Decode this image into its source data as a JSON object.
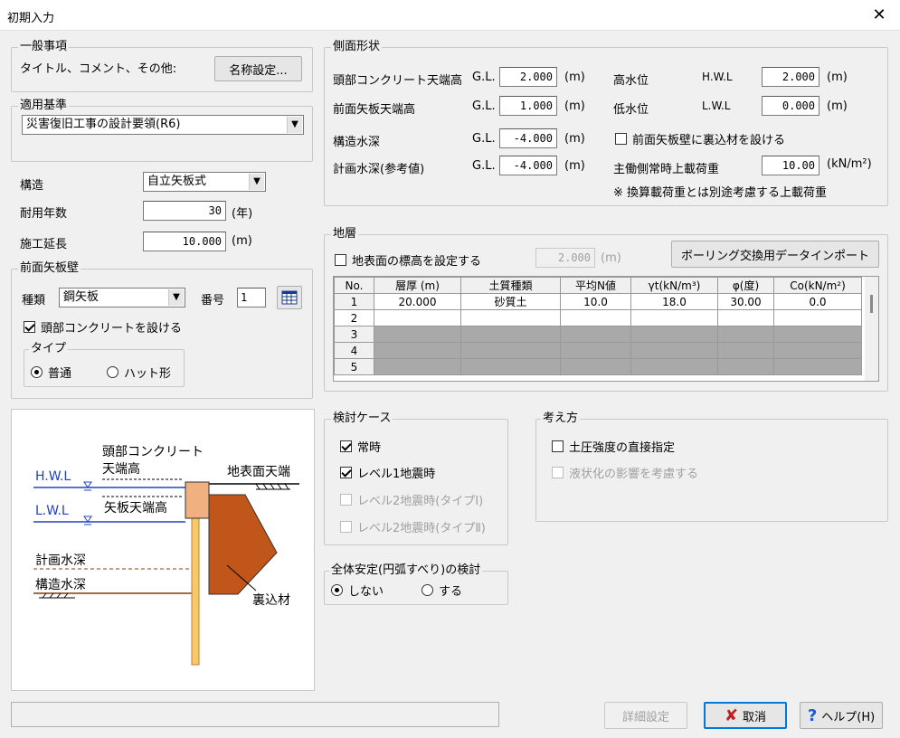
{
  "window": {
    "title": "初期入力",
    "close_glyph": "✕"
  },
  "general": {
    "label": "一般事項",
    "desc": "タイトル、コメント、その他:",
    "name_button": "名称設定..."
  },
  "standard": {
    "label": "適用基準",
    "value": "災害復旧工事の設計要領(R6)"
  },
  "structure": {
    "structure_label": "構造",
    "structure_value": "自立矢板式",
    "life_label": "耐用年数",
    "life_value": "30",
    "life_unit": "(年)",
    "length_label": "施工延長",
    "length_value": "10.000",
    "length_unit": "(m)"
  },
  "front_wall": {
    "label": "前面矢板壁",
    "kind_label": "種類",
    "kind_value": "鋼矢板",
    "number_label": "番号",
    "number_value": "1",
    "concrete_label": "頭部コンクリートを設ける",
    "type_label": "タイプ",
    "type_normal": "普通",
    "type_hat": "ハット形"
  },
  "diagram": {
    "label_head1": "頭部コンクリート",
    "label_head2": "天端高",
    "hwl": "H.W.L",
    "lwl": "L.W.L",
    "sheet_top": "矢板天端高",
    "ground_top": "地表面天端",
    "plan_depth": "計画水深",
    "struct_depth": "構造水深",
    "backfill": "裏込材"
  },
  "side": {
    "label": "側面形状",
    "head_top_label": "頭部コンクリート天端高",
    "gl": "G.L.",
    "head_top_value": "2.000",
    "unit_m": "(m)",
    "sheet_top_label": "前面矢板天端高",
    "sheet_top_value": "1.000",
    "struct_depth_label": "構造水深",
    "struct_depth_value": "-4.000",
    "plan_depth_label": "計画水深(参考値)",
    "plan_depth_value": "-4.000",
    "hwl_label": "高水位",
    "hwl_tag": "H.W.L",
    "hwl_value": "2.000",
    "lwl_label": "低水位",
    "lwl_tag": "L.W.L",
    "lwl_value": "0.000",
    "backfill_label": "前面矢板壁に裏込材を設ける",
    "load_label": "主働側常時上載荷重",
    "load_value": "10.00",
    "load_unit": "(kN/m²)",
    "note": "※ 換算載荷重とは別途考慮する上載荷重"
  },
  "strata": {
    "label": "地層",
    "surface_label": "地表面の標高を設定する",
    "surface_value": "2.000",
    "surface_unit": "(m)",
    "import_button": "ボーリング交換用データインポート",
    "headers": [
      "No.",
      "層厚 (m)",
      "土質種類",
      "平均N値",
      "γt(kN/m³)",
      "φ(度)",
      "Co(kN/m²)"
    ],
    "rows": [
      [
        "1",
        "20.000",
        "砂質土",
        "10.0",
        "18.0",
        "30.00",
        "0.0"
      ],
      [
        "2",
        "",
        "",
        "",
        "",
        "",
        ""
      ],
      [
        "3",
        "",
        "",
        "",
        "",
        "",
        ""
      ],
      [
        "4",
        "",
        "",
        "",
        "",
        "",
        ""
      ],
      [
        "5",
        "",
        "",
        "",
        "",
        "",
        ""
      ]
    ]
  },
  "cases": {
    "label": "検討ケース",
    "normal": "常時",
    "l1": "レベル1地震時",
    "l2a": "レベル2地震時(タイプⅠ)",
    "l2b": "レベル2地震時(タイプⅡ)"
  },
  "approach": {
    "label": "考え方",
    "direct": "土圧強度の直接指定",
    "liquefaction": "液状化の影響を考慮する"
  },
  "stability": {
    "label": "全体安定(円弧すべり)の検討",
    "no": "しない",
    "yes": "する"
  },
  "footer": {
    "detail_button": "詳細設定",
    "cancel_button": "取消",
    "help_button": "ヘルプ(H)"
  },
  "colors": {
    "water": "#2040c0",
    "backfill": "#c0561a",
    "sheet": "#f7c86a",
    "accent": "#0078d7"
  }
}
